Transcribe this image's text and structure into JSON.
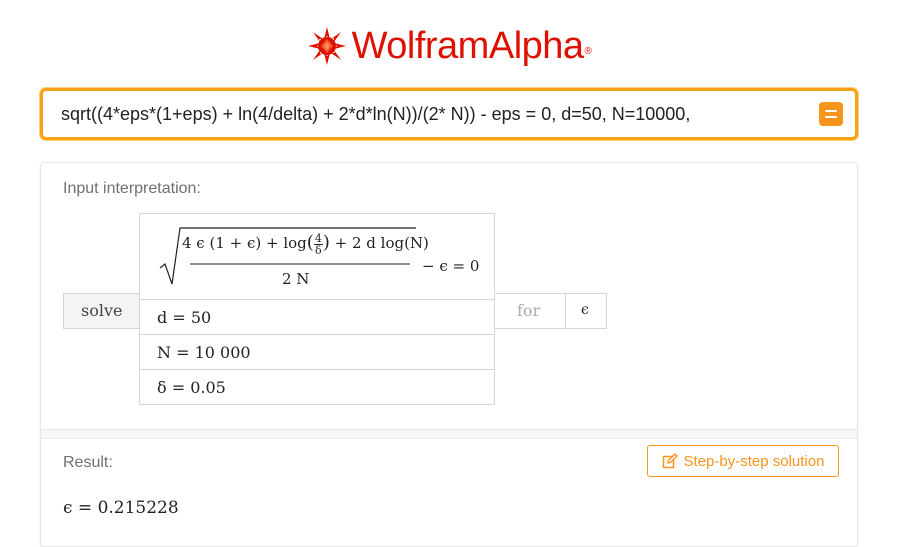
{
  "header": {
    "logo_name": "WolframAlpha",
    "logo_part1": "Wolfram",
    "logo_part2": "Alpha",
    "logo_mark": "®",
    "logo_icon": "wolfram-spikey-icon"
  },
  "search": {
    "query": "sqrt((4*eps*(1+eps) + ln(4/delta) + 2*d*ln(N))/(2* N)) - eps = 0, d=50, N=10000, ",
    "button_icon": "equal-sign-icon"
  },
  "input_interpretation": {
    "title": "Input interpretation:",
    "solve_label": "solve",
    "for_label": "for",
    "variable": "ϵ",
    "equation": {
      "numerator_a": "4 ϵ (1 + ϵ) + log",
      "frac_num": "4",
      "frac_den": "δ",
      "numerator_b": "+ 2 d log(N)",
      "denominator": "2 N",
      "rhs": "− ϵ = 0"
    },
    "conditions": [
      "d = 50",
      "N = 10 000",
      "δ = 0.05"
    ]
  },
  "result": {
    "title": "Result:",
    "value": "ϵ = 0.215228",
    "step_button": "Step-by-step solution",
    "step_icon": "edit-pencil-icon"
  },
  "colors": {
    "brand_red": "#dd1100",
    "accent_orange": "#f7941d",
    "search_border": "#f8a316"
  }
}
